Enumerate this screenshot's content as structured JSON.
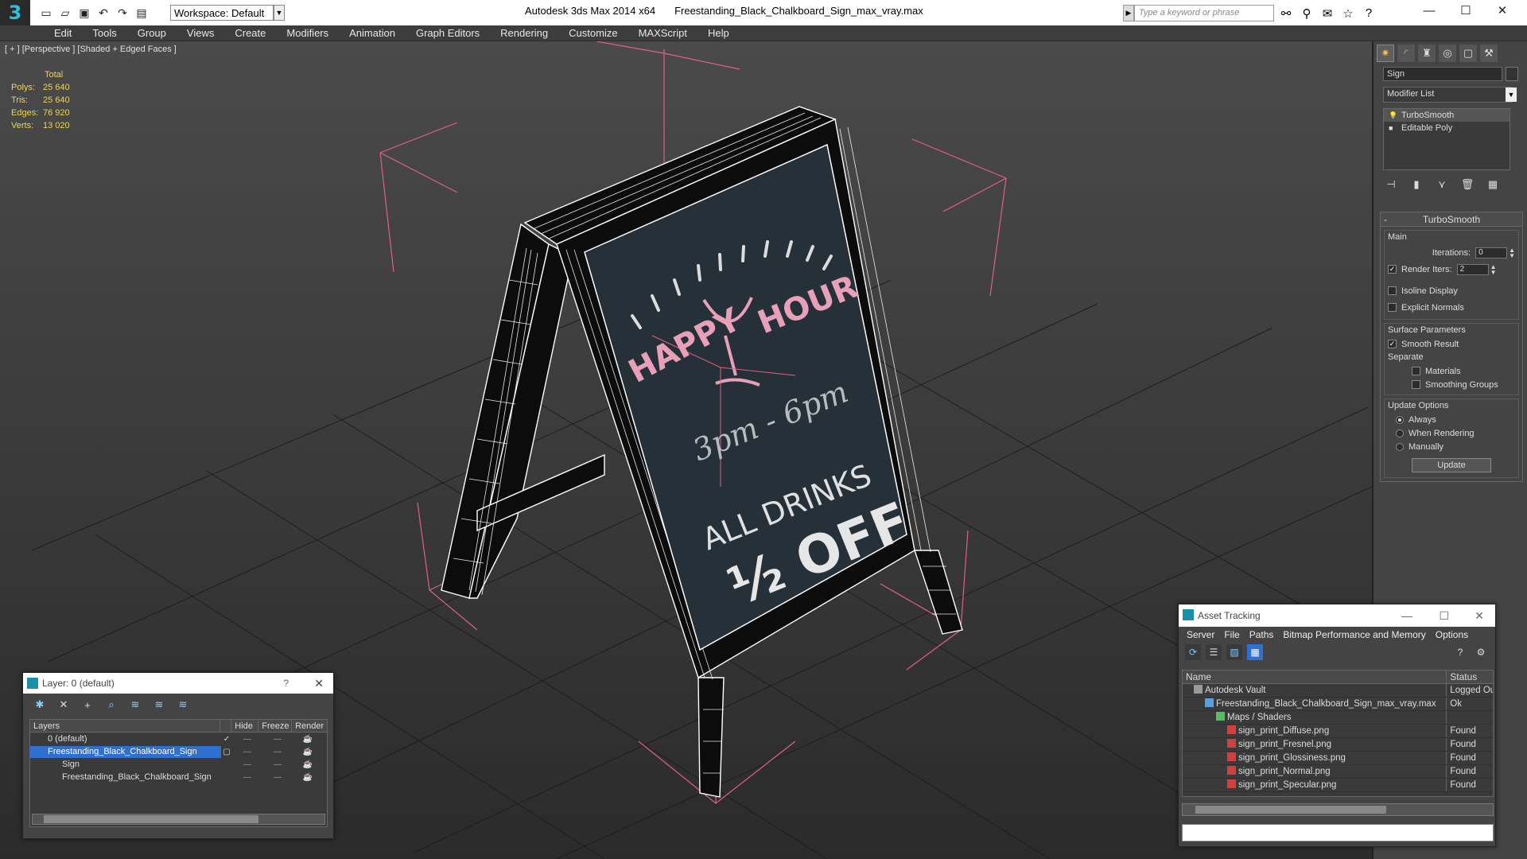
{
  "titlebar": {
    "app": "Autodesk 3ds Max  2014 x64",
    "file": "Freestanding_Black_Chalkboard_Sign_max_vray.max",
    "workspace": "Workspace: Default",
    "search_placeholder": "Type a keyword or phrase"
  },
  "menu": [
    "Edit",
    "Tools",
    "Group",
    "Views",
    "Create",
    "Modifiers",
    "Animation",
    "Graph Editors",
    "Rendering",
    "Customize",
    "MAXScript",
    "Help"
  ],
  "viewport": {
    "label": "[ + ] [Perspective ] [Shaded + Edged Faces ]",
    "stats_header": "Total",
    "stats": [
      {
        "k": "Polys:",
        "v": "25 640"
      },
      {
        "k": "Tris:",
        "v": "25 640"
      },
      {
        "k": "Edges:",
        "v": "76 920"
      },
      {
        "k": "Verts:",
        "v": "13 020"
      }
    ],
    "chalk": {
      "line1a": "HAPPY",
      "line1b": "HOUR",
      "line2": "3pm - 6pm",
      "line3": "ALL DRINKS",
      "line4": "½ OFF"
    }
  },
  "command_panel": {
    "object_name": "Sign",
    "modifier_list": "Modifier List",
    "stack": [
      "TurboSmooth",
      "Editable Poly"
    ],
    "rollout_title": "TurboSmooth",
    "main_label": "Main",
    "iterations_label": "Iterations:",
    "iterations_value": "0",
    "render_iters_label": "Render Iters:",
    "render_iters_value": "2",
    "isoline": "Isoline Display",
    "explicit": "Explicit Normals",
    "surface_label": "Surface Parameters",
    "smooth_result": "Smooth Result",
    "separate": "Separate",
    "materials": "Materials",
    "smoothing_groups": "Smoothing Groups",
    "update_label": "Update Options",
    "always": "Always",
    "when_rendering": "When Rendering",
    "manually": "Manually",
    "update_button": "Update"
  },
  "layer_dialog": {
    "title": "Layer: 0 (default)",
    "help": "?",
    "columns": [
      "Layers",
      "Hide",
      "Freeze",
      "Render"
    ],
    "rows": [
      {
        "name": "0 (default)",
        "indent": 1
      },
      {
        "name": "Freestanding_Black_Chalkboard_Sign",
        "indent": 1,
        "selected": true
      },
      {
        "name": "Sign",
        "indent": 2
      },
      {
        "name": "Freestanding_Black_Chalkboard_Sign",
        "indent": 2
      }
    ]
  },
  "asset_dialog": {
    "title": "Asset Tracking",
    "menu": [
      "Server",
      "File",
      "Paths",
      "Bitmap Performance and Memory",
      "Options"
    ],
    "columns": [
      "Name",
      "Status"
    ],
    "rows": [
      {
        "name": "Autodesk Vault",
        "status": "Logged Out",
        "indent": 1
      },
      {
        "name": "Freestanding_Black_Chalkboard_Sign_max_vray.max",
        "status": "Ok",
        "indent": 2
      },
      {
        "name": "Maps / Shaders",
        "status": "",
        "indent": 3
      },
      {
        "name": "sign_print_Diffuse.png",
        "status": "Found",
        "indent": 4
      },
      {
        "name": "sign_print_Fresnel.png",
        "status": "Found",
        "indent": 4
      },
      {
        "name": "sign_print_Glossiness.png",
        "status": "Found",
        "indent": 4
      },
      {
        "name": "sign_print_Normal.png",
        "status": "Found",
        "indent": 4
      },
      {
        "name": "sign_print_Specular.png",
        "status": "Found",
        "indent": 4
      }
    ]
  },
  "colors": {
    "selection": "#2f6fd0",
    "stats": "#e8d65a",
    "chalk_pink": "#e8a0b8",
    "gizmo": "#e06080"
  }
}
